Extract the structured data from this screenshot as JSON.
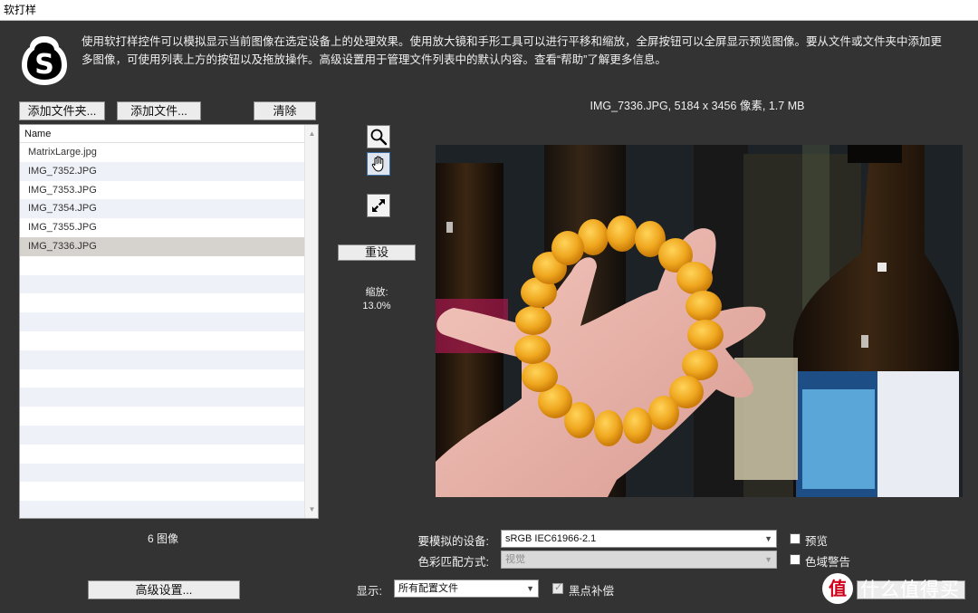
{
  "window": {
    "title": "软打样"
  },
  "logo": {
    "letter": "S"
  },
  "description": "使用软打样控件可以模拟显示当前图像在选定设备上的处理效果。使用放大镜和手形工具可以进行平移和缩放，全屏按钮可以全屏显示预览图像。要从文件或文件夹中添加更多图像，可使用列表上方的按钮以及拖放操作。高级设置用于管理文件列表中的默认内容。查看“帮助”了解更多信息。",
  "toolbar": {
    "add_folder": "添加文件夹...",
    "add_file": "添加文件...",
    "clear": "清除"
  },
  "file_list": {
    "header": "Name",
    "items": [
      "MatrixLarge.jpg",
      "IMG_7352.JPG",
      "IMG_7353.JPG",
      "IMG_7354.JPG",
      "IMG_7355.JPG",
      "IMG_7336.JPG"
    ],
    "selected": "IMG_7336.JPG",
    "count_label": "6 图像"
  },
  "tools": {
    "zoom_icon": "magnifier-icon",
    "hand_icon": "hand-icon",
    "fullscreen_icon": "expand-icon",
    "active": "hand"
  },
  "reset_label": "重设",
  "zoom": {
    "label": "缩放:",
    "value": "13.0%"
  },
  "image_info": "IMG_7336.JPG, 5184 x 3456 像素, 1.7 MB",
  "settings": {
    "device_label": "要模拟的设备:",
    "device_value": "sRGB IEC61966-2.1",
    "intent_label": "色彩匹配方式:",
    "intent_value": "视觉",
    "display_label": "显示:",
    "display_value": "所有配置文件",
    "blackpoint_label": "黑点补偿",
    "preview_label": "预览",
    "gamut_label": "色域警告",
    "advanced_label": "高级设置..."
  },
  "watermark": {
    "badge": "值",
    "text": "什么值得买"
  },
  "colors": {
    "background": "#333333",
    "bead": "#f0a820",
    "selection": "#d6d2cd",
    "stripe": "#eef1f7"
  }
}
